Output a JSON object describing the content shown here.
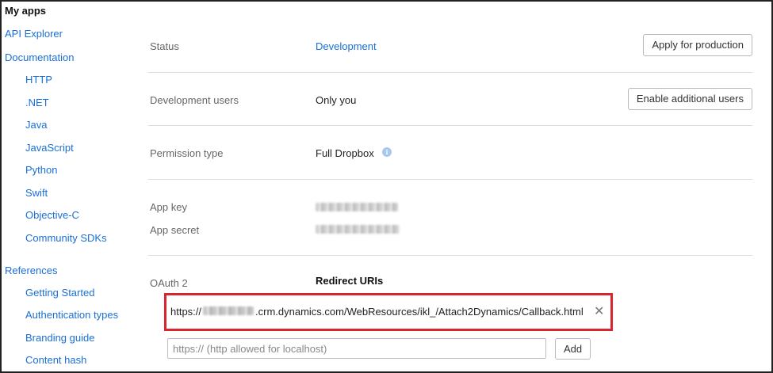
{
  "sidebar": {
    "heading": "My apps",
    "items": [
      {
        "label": "API Explorer",
        "level": "top"
      },
      {
        "label": "Documentation",
        "level": "top"
      },
      {
        "label": "HTTP",
        "level": "sub"
      },
      {
        "label": ".NET",
        "level": "sub"
      },
      {
        "label": "Java",
        "level": "sub"
      },
      {
        "label": "JavaScript",
        "level": "sub"
      },
      {
        "label": "Python",
        "level": "sub"
      },
      {
        "label": "Swift",
        "level": "sub"
      },
      {
        "label": "Objective-C",
        "level": "sub"
      },
      {
        "label": "Community SDKs",
        "level": "sub"
      },
      {
        "label": "References",
        "level": "top"
      },
      {
        "label": "Getting Started",
        "level": "sub"
      },
      {
        "label": "Authentication types",
        "level": "sub"
      },
      {
        "label": "Branding guide",
        "level": "sub"
      },
      {
        "label": "Content hash",
        "level": "sub"
      }
    ]
  },
  "settings": {
    "status": {
      "label": "Status",
      "value": "Development",
      "button": "Apply for production"
    },
    "dev_users": {
      "label": "Development users",
      "value": "Only you",
      "button": "Enable additional users"
    },
    "permission": {
      "label": "Permission type",
      "value": "Full Dropbox",
      "info_icon": "info-icon"
    },
    "app_key": {
      "label": "App key"
    },
    "app_secret": {
      "label": "App secret"
    },
    "oauth": {
      "label": "OAuth 2",
      "redirect_heading": "Redirect URIs",
      "uri_prefix": "https://",
      "uri_suffix": ".crm.dynamics.com/WebResources/ikl_/Attach2Dynamics/Callback.html",
      "remove_symbol": "✕",
      "input_placeholder": "https:// (http allowed for localhost)",
      "add_button": "Add"
    }
  },
  "colors": {
    "link": "#1a6fd6",
    "highlight_border": "#d9262e"
  }
}
